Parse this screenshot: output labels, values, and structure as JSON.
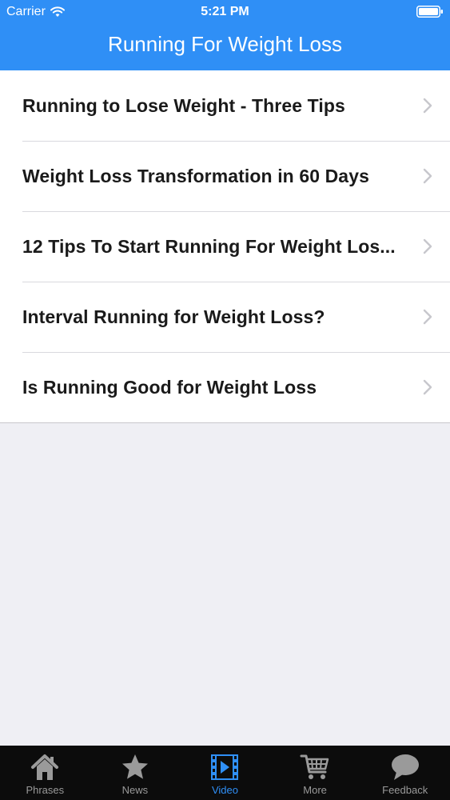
{
  "status_bar": {
    "carrier": "Carrier",
    "time": "5:21 PM"
  },
  "nav": {
    "title": "Running For Weight Loss"
  },
  "list": {
    "items": [
      {
        "label": "Running to Lose Weight - Three Tips"
      },
      {
        "label": "Weight Loss Transformation in 60 Days"
      },
      {
        "label": "12 Tips To Start Running For Weight Los..."
      },
      {
        "label": "Interval Running for Weight Loss?"
      },
      {
        "label": "Is Running Good for Weight Loss"
      }
    ]
  },
  "tab_bar": {
    "tabs": [
      {
        "label": "Phrases",
        "icon": "home-icon"
      },
      {
        "label": "News",
        "icon": "star-icon"
      },
      {
        "label": "Video",
        "icon": "film-icon",
        "active": true
      },
      {
        "label": "More",
        "icon": "cart-icon"
      },
      {
        "label": "Feedback",
        "icon": "speech-bubble-icon"
      }
    ]
  },
  "colors": {
    "accent": "#2f8ff6",
    "tab_bar_bg": "#0c0c0c",
    "tab_inactive": "#9a9a9a",
    "background": "#efeff4"
  }
}
